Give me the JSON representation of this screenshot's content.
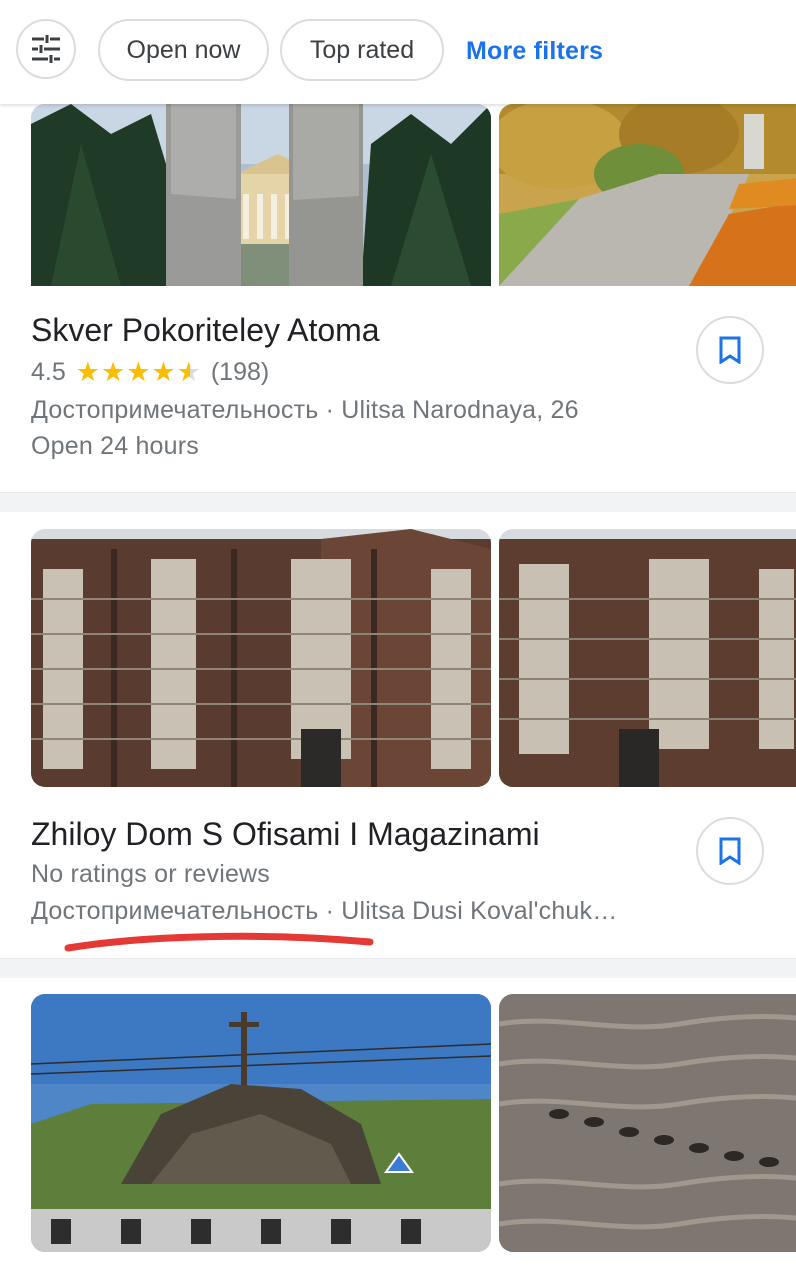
{
  "filters": {
    "filter_icon": "tune-icon",
    "chips": [
      "Open now",
      "Top rated"
    ],
    "more_filters": "More filters"
  },
  "results": [
    {
      "title": "Skver Pokoriteley Atoma",
      "rating": "4.5",
      "rating_value": 4.5,
      "reviews": "(198)",
      "meta": "Достопримечательность · Ulitsa Narodnaya, 26",
      "hours": "Open 24 hours",
      "save_icon": "bookmark-icon"
    },
    {
      "title": "Zhiloy Dom S Ofisami I Magazinami",
      "no_ratings": "No ratings or reviews",
      "meta": "Достопримечательность · Ulitsa Dusi Koval'chuk…",
      "save_icon": "bookmark-icon",
      "annotation": "red-underline"
    }
  ],
  "colors": {
    "accent": "#1a73e8",
    "star": "#fbbc04",
    "annotation": "#e53935"
  }
}
